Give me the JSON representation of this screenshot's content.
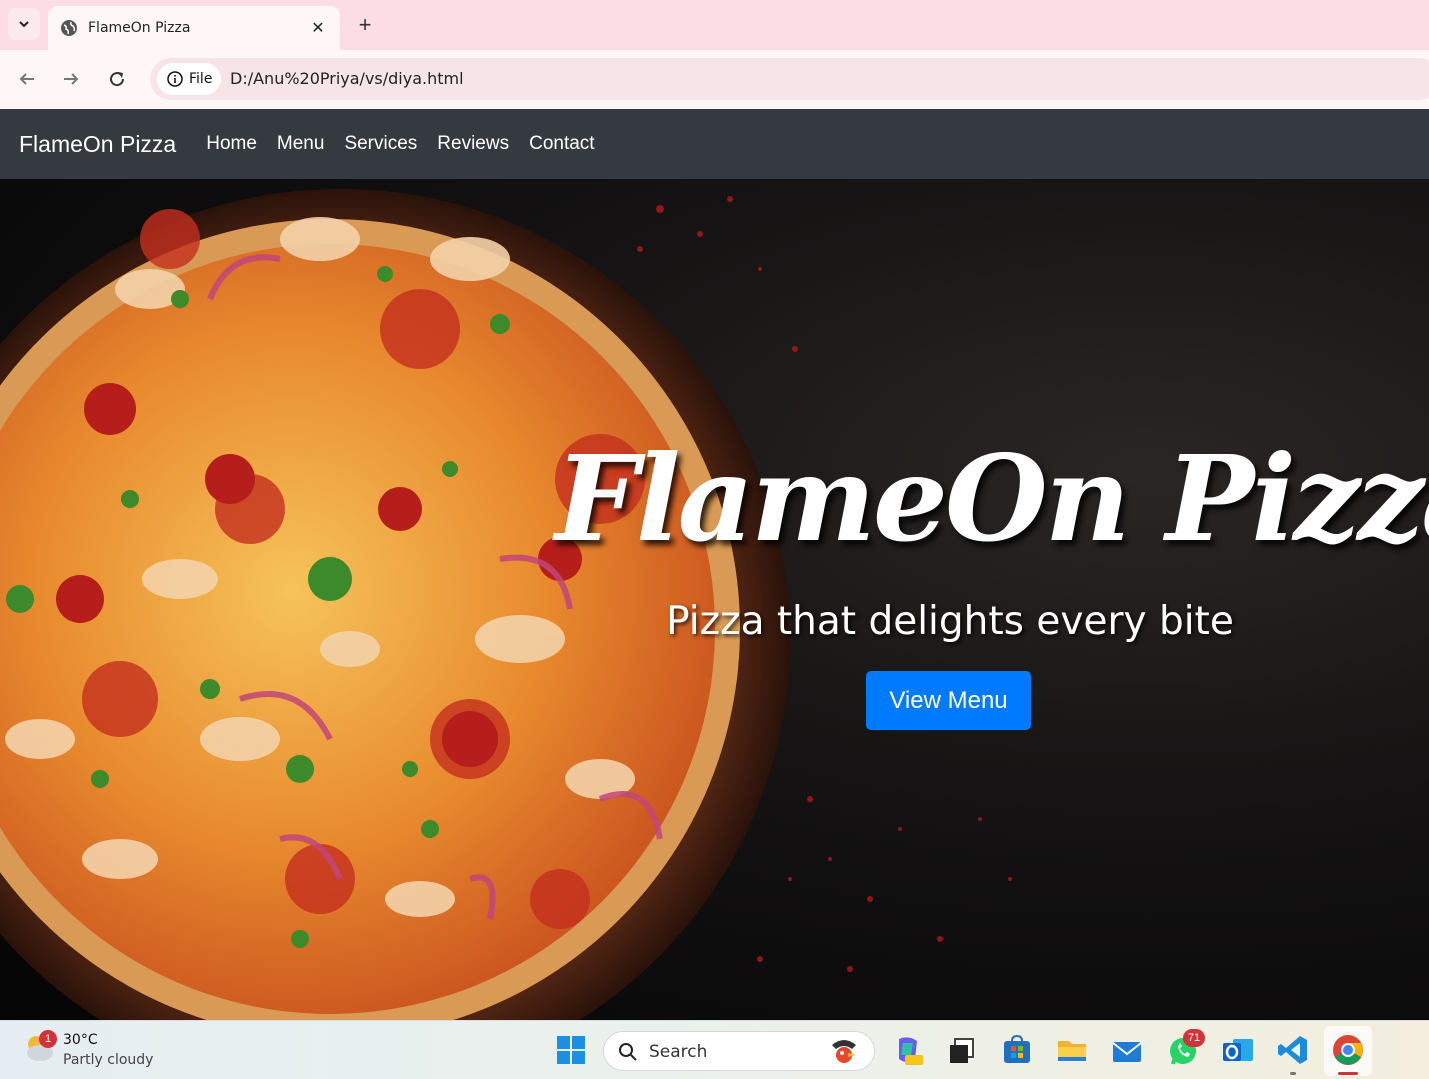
{
  "browser": {
    "tab_title": "FlameOn Pizza",
    "tab_close": "✕",
    "new_tab": "+",
    "site_chip_label": "File",
    "url": "D:/Anu%20Priya/vs/diya.html"
  },
  "site": {
    "brand": "FlameOn Pizza",
    "nav": [
      "Home",
      "Menu",
      "Services",
      "Reviews",
      "Contact"
    ]
  },
  "hero": {
    "title": "FlameOn Pizza",
    "subtitle": "Pizza that delights every bite",
    "cta": "View Menu"
  },
  "taskbar": {
    "weather_badge": "1",
    "temperature": "30°C",
    "condition": "Partly cloudy",
    "search_placeholder": "Search",
    "whatsapp_badge": "71",
    "apps": [
      "copilot-icon",
      "task-view-icon",
      "store-icon",
      "file-explorer-icon",
      "mail-icon",
      "whatsapp-icon",
      "outlook-icon",
      "vscode-icon",
      "chrome-icon"
    ]
  },
  "colors": {
    "navbar": "#343a40",
    "cta": "#007bff",
    "tabstrip": "#fddde4"
  }
}
